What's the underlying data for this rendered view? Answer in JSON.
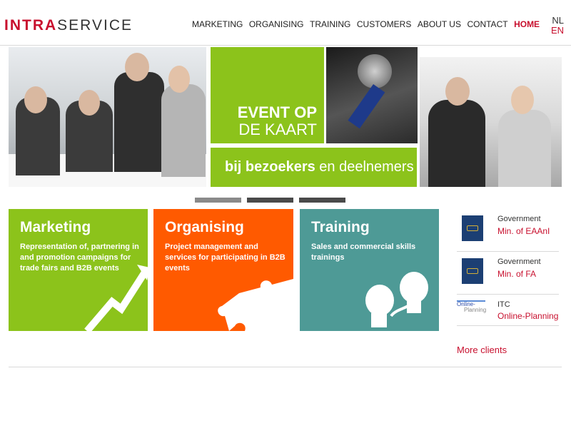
{
  "logo": {
    "part1": "INTRA",
    "part2": "SERVICE"
  },
  "nav": {
    "items": [
      {
        "label": "MARKETING"
      },
      {
        "label": "ORGANISING"
      },
      {
        "label": "TRAINING"
      },
      {
        "label": "CUSTOMERS"
      },
      {
        "label": "ABOUT US"
      },
      {
        "label": "CONTACT"
      },
      {
        "label": "HOME"
      }
    ],
    "active": "HOME"
  },
  "languages": {
    "nl": "NL",
    "en": "EN",
    "active": "EN"
  },
  "banner": {
    "headline_line1": "EVENT OP",
    "headline_line2": "DE KAART",
    "subline_bold": "bij bezoekers",
    "subline_rest": " en deelnemers"
  },
  "slider": {
    "count": 3,
    "active": 1
  },
  "tiles": [
    {
      "title": "Marketing",
      "text": "Representation of, partnering in and promotion campaigns for trade fairs and B2B events",
      "color": "#8cc31b"
    },
    {
      "title": "Organising",
      "text": "Project management and services for participating in B2B events",
      "color": "#ff5a00"
    },
    {
      "title": "Training",
      "text": "Sales and commercial skills trainings",
      "color": "#4e9a96"
    }
  ],
  "clients": [
    {
      "category": "Government",
      "name": "Min. of EAAnI",
      "icon": "government-crest-icon"
    },
    {
      "category": "Government",
      "name": "Min. of FA",
      "icon": "government-crest-icon"
    },
    {
      "category": "ITC",
      "name": "Online-Planning",
      "logo_text_1": "Online-",
      "logo_text_2": "Planning"
    }
  ],
  "more_clients": "More clients",
  "colors": {
    "brand_red": "#c8102e",
    "green": "#8cc31b",
    "orange": "#ff5a00",
    "teal": "#4e9a96"
  }
}
